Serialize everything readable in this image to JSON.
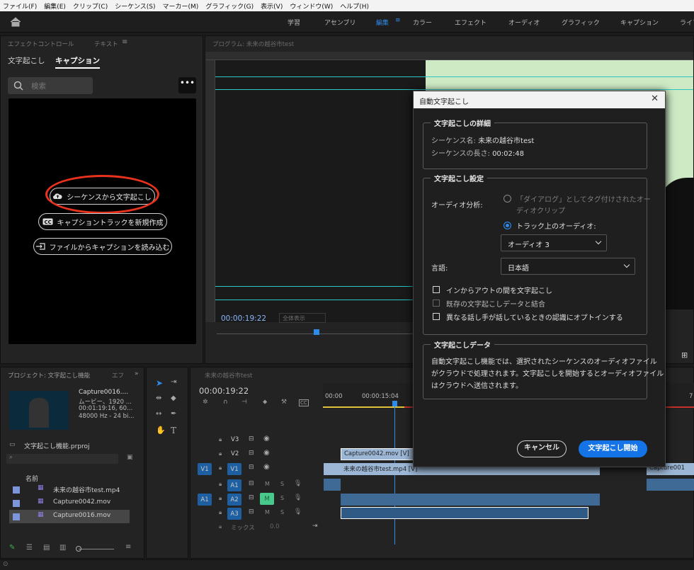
{
  "menu": [
    "ファイル(F)",
    "編集(E)",
    "クリップ(C)",
    "シーケンス(S)",
    "マーカー(M)",
    "グラフィック(G)",
    "表示(V)",
    "ウィンドウ(W)",
    "ヘルプ(H)"
  ],
  "workspaces": [
    "学習",
    "アセンブリ",
    "編集",
    "カラー",
    "エフェクト",
    "オーディオ",
    "グラフィック",
    "キャプション",
    "ライブ"
  ],
  "left_panel": {
    "tab1": "エフェクトコントロール",
    "tab2": "テキスト",
    "subtab_transcript": "文字起こし",
    "subtab_caption": "キャプション",
    "search_placeholder": "検索",
    "btn_transcribe": "シーケンスから文字起こし",
    "btn_new_track": "キャプショントラックを新規作成",
    "btn_import": "ファイルからキャプションを読み込む"
  },
  "program": {
    "title": "プログラム: 未来の越谷市test",
    "timecode": "00:00:19:22",
    "zoom": "全体表示"
  },
  "dialog": {
    "title": "自動文字起こし",
    "details_legend": "文字起こしの詳細",
    "seq_name_label": "シーケンス名:",
    "seq_name": "未来の越谷市test",
    "seq_len_label": "シーケンスの長さ:",
    "seq_len": "00:02:48",
    "settings_legend": "文字起こし設定",
    "audio_label": "オーディオ分析:",
    "radio1_line1": "「ダイアログ」としてタグ付けされたオー",
    "radio1_line2": "ディオクリップ",
    "radio2": "トラック上のオーディオ:",
    "audio_select": "オーディオ 3",
    "lang_label": "言語:",
    "lang_select": "日本語",
    "cb1": "インからアウトの間を文字起こし",
    "cb2": "既存の文字起こしデータと結合",
    "cb3": "異なる話し手が話しているときの認識にオプトインする",
    "data_legend": "文字起こしデータ",
    "data_line1": "自動文字起こし機能では、選択されたシーケンスのオーディオファイル",
    "data_line2": "がクラウドで処理されます。文字起こしを開始するとオーディオファイル",
    "data_line3": "はクラウドへ送信されます。",
    "cancel": "キャンセル",
    "start": "文字起こし開始"
  },
  "project": {
    "tab1": "プロジェクト: 文字起こし機能",
    "tab2": "エフ",
    "clip_name": "Capture0016....",
    "clip_type": "ムービー、1920 ...",
    "clip_dur": "00:01:19:16, 60...",
    "clip_audio": "48000 Hz - 24 bi...",
    "proj_file": "文字起こし機能.prproj",
    "col_name": "名前",
    "items": [
      "未来の越谷市test.mp4",
      "Capture0042.mov",
      "Capture0016.mov"
    ]
  },
  "timeline": {
    "tab": "未来の越谷市test",
    "timecode": "00:00:19:22",
    "ruler": [
      "00:00",
      "00:00:15:04"
    ],
    "ruler_right": "7",
    "tracks": {
      "v3": "V3",
      "v2": "V2",
      "v1": "V1",
      "a1": "A1",
      "a2": "A2",
      "a3": "A3",
      "mix": "ミックス",
      "mix_val": "0.0",
      "src_v1": "V1",
      "src_a1": "A1"
    },
    "clip_v2": "Capture0042.mov [V]",
    "clip_v1": "未来の越谷市test.mp4 [V]",
    "clip_v1_right": "Capture001"
  },
  "colors": {
    "accent": "#2d8ceb",
    "dialog_btn": "#1473e6",
    "highlight": "#e8321e"
  }
}
